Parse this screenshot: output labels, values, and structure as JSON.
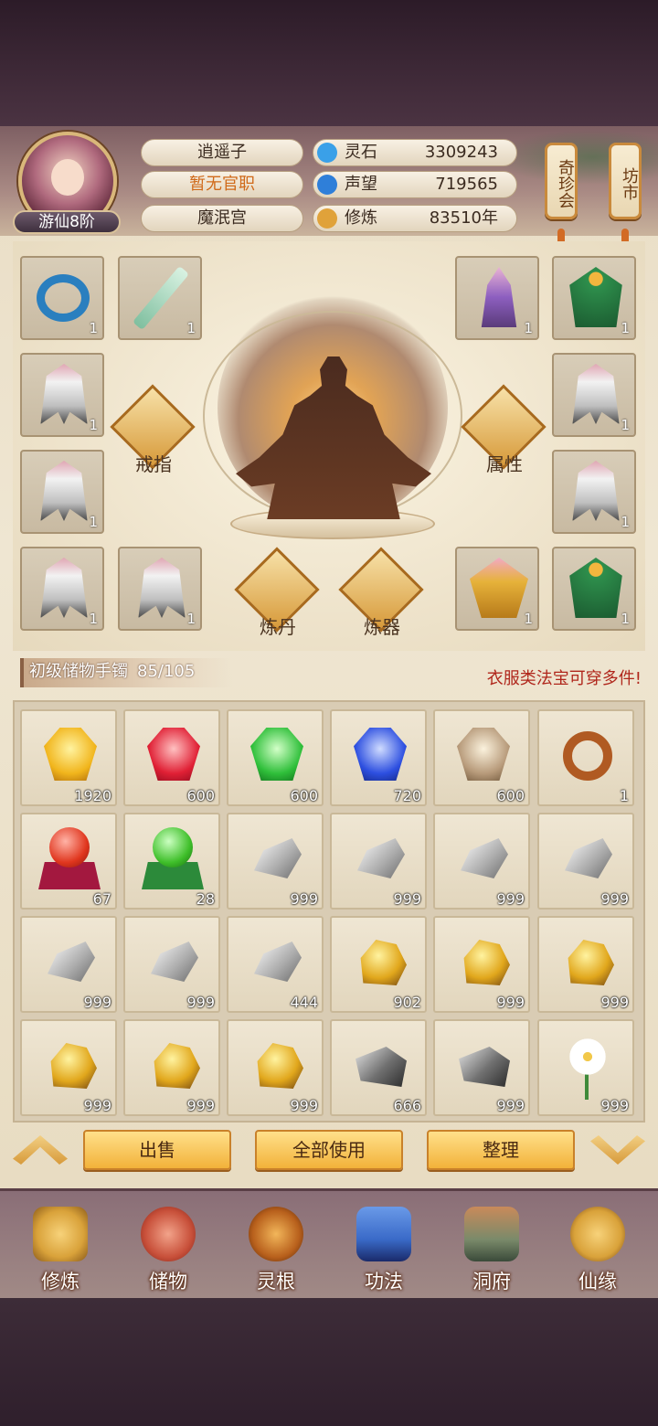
{
  "player": {
    "name": "逍遥子",
    "rank": "游仙8阶",
    "office": "暂无官职",
    "sect": "魔泯宫"
  },
  "stats": [
    {
      "label": "灵石",
      "value": "3309243",
      "icon": "spirit-stone-icon",
      "color": "#3aa0e8"
    },
    {
      "label": "声望",
      "value": "719565",
      "icon": "reputation-icon",
      "color": "#2f7fd9"
    },
    {
      "label": "修炼",
      "value": "83510年",
      "icon": "cultivation-icon",
      "color": "#e0a23a"
    }
  ],
  "shortcuts": [
    {
      "label": "奇珍会"
    },
    {
      "label": "坊市"
    }
  ],
  "equipment": {
    "left": [
      {
        "name": "ring",
        "qty": "1"
      },
      {
        "name": "sword",
        "qty": "1"
      },
      {
        "name": "claw",
        "qty": "1"
      },
      {
        "name": "claw",
        "qty": "1"
      },
      {
        "name": "claw",
        "qty": "1"
      },
      {
        "name": "claw",
        "qty": "1"
      }
    ],
    "right": [
      {
        "name": "figure",
        "qty": "1"
      },
      {
        "name": "green-robe",
        "qty": "1"
      },
      {
        "name": "claw",
        "qty": "1"
      },
      {
        "name": "claw",
        "qty": "1"
      },
      {
        "name": "gold-robe",
        "qty": "1"
      },
      {
        "name": "green-robe",
        "qty": "1"
      }
    ],
    "buttons": [
      {
        "label": "戒指",
        "icon": "ring-icon"
      },
      {
        "label": "属性",
        "icon": "attribute-icon"
      },
      {
        "label": "炼丹",
        "icon": "cauldron-icon"
      },
      {
        "label": "炼器",
        "icon": "anvil-icon"
      }
    ]
  },
  "bag": {
    "title": "初级储物手镯",
    "capacity": "85/105",
    "hint": "衣服类法宝可穿多件!"
  },
  "items": [
    {
      "type": "gem-gold",
      "qty": "1920"
    },
    {
      "type": "gem-red",
      "qty": "600"
    },
    {
      "type": "gem-green",
      "qty": "600"
    },
    {
      "type": "gem-blue",
      "qty": "720"
    },
    {
      "type": "gem-brown",
      "qty": "600"
    },
    {
      "type": "ring",
      "qty": "1"
    },
    {
      "type": "orb-red",
      "qty": "67"
    },
    {
      "type": "orb-green",
      "qty": "28"
    },
    {
      "type": "ore-silver",
      "qty": "999"
    },
    {
      "type": "ore-silver",
      "qty": "999"
    },
    {
      "type": "ore-silver",
      "qty": "999"
    },
    {
      "type": "ore-silver",
      "qty": "999"
    },
    {
      "type": "ore-silver",
      "qty": "999"
    },
    {
      "type": "ore-silver",
      "qty": "999"
    },
    {
      "type": "ore-silver",
      "qty": "444"
    },
    {
      "type": "ore-gold",
      "qty": "902"
    },
    {
      "type": "ore-gold",
      "qty": "999"
    },
    {
      "type": "ore-gold",
      "qty": "999"
    },
    {
      "type": "ore-gold",
      "qty": "999"
    },
    {
      "type": "ore-gold",
      "qty": "999"
    },
    {
      "type": "ore-gold",
      "qty": "999"
    },
    {
      "type": "ore-dark",
      "qty": "666"
    },
    {
      "type": "ore-dark",
      "qty": "999"
    },
    {
      "type": "flower",
      "qty": "999"
    }
  ],
  "actions": {
    "sell": "出售",
    "use_all": "全部使用",
    "sort": "整理"
  },
  "nav": [
    {
      "label": "修炼",
      "icon": "cultivate-icon",
      "color": "#d9a23a"
    },
    {
      "label": "储物",
      "icon": "storage-bag-icon",
      "color": "#c8503a"
    },
    {
      "label": "灵根",
      "icon": "spirit-root-icon",
      "color": "#b8601c"
    },
    {
      "label": "功法",
      "icon": "skill-book-icon",
      "color": "#3a6ac8"
    },
    {
      "label": "洞府",
      "icon": "cave-house-icon",
      "color": "#7a8a6a"
    },
    {
      "label": "仙缘",
      "icon": "fortune-gourd-icon",
      "color": "#d9a23a"
    }
  ]
}
